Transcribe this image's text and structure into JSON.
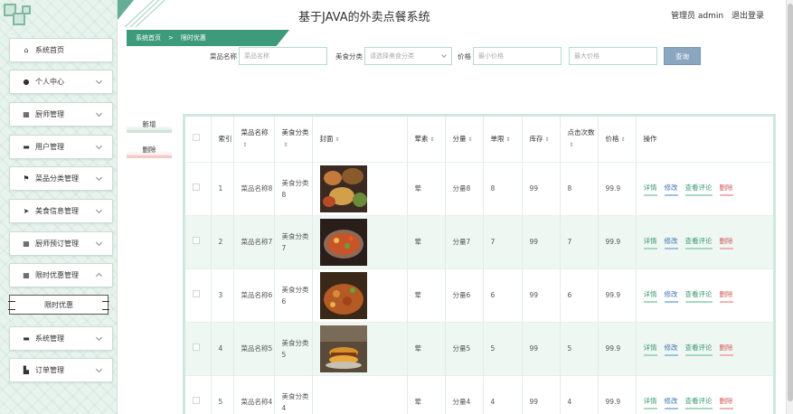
{
  "app": {
    "title": "基于JAVA的外卖点餐系统",
    "user_label": "管理员 admin",
    "logout_label": "退出登录"
  },
  "sidebar": {
    "items": [
      {
        "label": "系统首页",
        "icon": "home-icon",
        "glyph": "⌂",
        "expandable": false
      },
      {
        "label": "个人中心",
        "icon": "person-icon",
        "glyph": "●",
        "expandable": true
      },
      {
        "label": "厨师管理",
        "icon": "grid-icon",
        "glyph": "▦",
        "expandable": true
      },
      {
        "label": "用户管理",
        "icon": "monitor-icon",
        "glyph": "▬",
        "expandable": true
      },
      {
        "label": "菜品分类管理",
        "icon": "flag-icon",
        "glyph": "⚑",
        "expandable": true
      },
      {
        "label": "美食信息管理",
        "icon": "send-icon",
        "glyph": "➤",
        "expandable": true
      },
      {
        "label": "厨师预订管理",
        "icon": "grid-icon",
        "glyph": "▦",
        "expandable": true
      },
      {
        "label": "限时优惠管理",
        "icon": "grid-icon",
        "glyph": "▦",
        "expandable": true,
        "expanded": true
      },
      {
        "label": "系统管理",
        "icon": "monitor-icon",
        "glyph": "▬",
        "expandable": true
      },
      {
        "label": "订单管理",
        "icon": "thumbs-up-icon",
        "glyph": "▙",
        "expandable": true
      }
    ],
    "sub_item": "限时优惠"
  },
  "breadcrumb": {
    "home": "系统首页",
    "separator": ">",
    "current": "限时优惠"
  },
  "search": {
    "name_label": "菜品名称",
    "name_placeholder": "菜品名称",
    "category_label": "美食分类",
    "category_placeholder": "请选择美食分类",
    "price_label": "价格",
    "min_price_placeholder": "最小价格",
    "max_price_placeholder": "最大价格",
    "button": "查询"
  },
  "actions": {
    "add": "新增",
    "delete": "删除"
  },
  "table": {
    "headers": {
      "index": "索引",
      "name": "菜品名称",
      "category": "美食分类",
      "cover": "封面",
      "taste": "荤素",
      "portion": "分量",
      "limit": "单限",
      "stock": "库存",
      "clicks": "点击次数",
      "price": "价格",
      "ops": "操作"
    },
    "op_labels": {
      "detail": "详情",
      "edit": "修改",
      "review": "查看评论",
      "delete": "删除"
    },
    "rows": [
      {
        "index": "1",
        "name": "菜品名称8",
        "category": "美食分类8",
        "taste": "荤",
        "portion": "分量8",
        "limit": "8",
        "stock": "99",
        "clicks": "8",
        "price": "99.9"
      },
      {
        "index": "2",
        "name": "菜品名称7",
        "category": "美食分类7",
        "taste": "荤",
        "portion": "分量7",
        "limit": "7",
        "stock": "99",
        "clicks": "7",
        "price": "99.9"
      },
      {
        "index": "3",
        "name": "菜品名称6",
        "category": "美食分类6",
        "taste": "荤",
        "portion": "分量6",
        "limit": "6",
        "stock": "99",
        "clicks": "6",
        "price": "99.9"
      },
      {
        "index": "4",
        "name": "菜品名称5",
        "category": "美食分类5",
        "taste": "荤",
        "portion": "分量5",
        "limit": "5",
        "stock": "99",
        "clicks": "5",
        "price": "99.9"
      },
      {
        "index": "5",
        "name": "菜品名称4",
        "category": "美食分类4",
        "taste": "荤",
        "portion": "分量4",
        "limit": "4",
        "stock": "99",
        "clicks": "4",
        "price": "99.9"
      }
    ]
  },
  "colors": {
    "accent": "#3d9a7a",
    "sidebar_bg": "#e8f3ee",
    "row_alt": "#eef7f2",
    "search_button": "#8aa6c1"
  }
}
